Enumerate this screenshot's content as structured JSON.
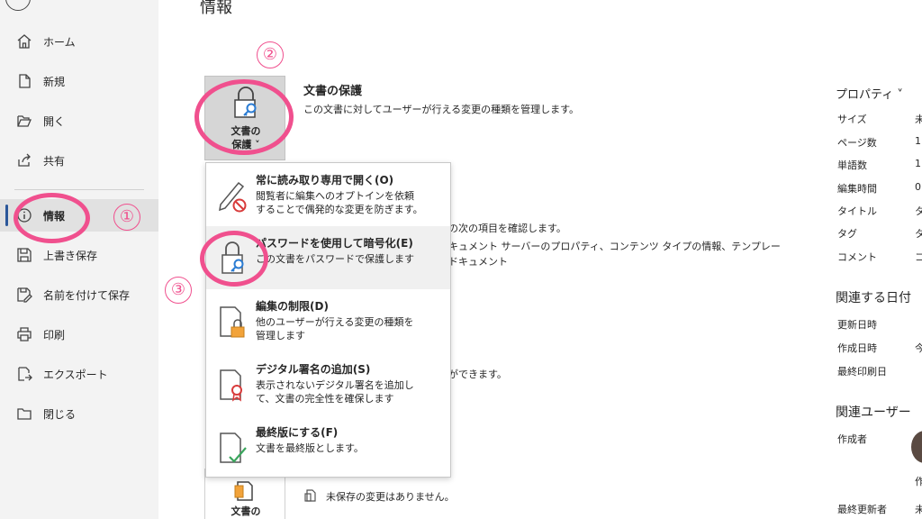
{
  "page": {
    "title": "情報"
  },
  "nav": {
    "items": [
      {
        "label": "ホーム",
        "icon": "home-icon"
      },
      {
        "label": "新規",
        "icon": "new-doc-icon"
      },
      {
        "label": "開く",
        "icon": "folder-open-icon"
      },
      {
        "label": "共有",
        "icon": "share-icon"
      },
      {
        "label": "情報",
        "icon": "info-icon",
        "selected": true
      },
      {
        "label": "上書き保存",
        "icon": "save-icon"
      },
      {
        "label": "名前を付けて保存",
        "icon": "save-as-icon"
      },
      {
        "label": "印刷",
        "icon": "print-icon"
      },
      {
        "label": "エクスポート",
        "icon": "export-icon"
      },
      {
        "label": "閉じる",
        "icon": "close-folder-icon"
      }
    ]
  },
  "protect": {
    "button_line1": "文書の",
    "button_line2": "保護 ˅",
    "title": "文書の保護",
    "description": "この文書に対してユーザーが行える変更の種類を管理します。"
  },
  "inspect": {
    "line1": "の次の項目を確認します。",
    "line2": "キュメント サーバーのプロパティ、コンテンツ タイプの情報、テンプレー",
    "line3": "ドキュメント"
  },
  "versions": {
    "description": "ができます。"
  },
  "manage": {
    "button_label": "文書の",
    "status": "未保存の変更はありません。"
  },
  "dropdown": {
    "items": [
      {
        "title": "常に読み取り専用で開く(O)",
        "description": "閲覧者に編集へのオプトインを依頼\nすることで偶発的な変更を防ぎます。",
        "icon": "read-only-pencil-icon"
      },
      {
        "title": "パスワードを使用して暗号化(E)",
        "description": "この文書をパスワードで保護します",
        "icon": "lock-key-icon"
      },
      {
        "title": "編集の制限(D)",
        "description": "他のユーザーが行える変更の種類を\n管理します",
        "icon": "restrict-editing-icon"
      },
      {
        "title": "デジタル署名の追加(S)",
        "description": "表示されないデジタル署名を追加し\nて、文書の完全性を確保します",
        "icon": "digital-signature-icon"
      },
      {
        "title": "最終版にする(F)",
        "description": "文書を最終版とします。",
        "icon": "mark-final-icon"
      }
    ]
  },
  "properties": {
    "header": "プロパティ ˅",
    "rows": [
      {
        "label": "サイズ",
        "value": "未"
      },
      {
        "label": "ページ数",
        "value": "1"
      },
      {
        "label": "単語数",
        "value": "1"
      },
      {
        "label": "編集時間",
        "value": "0"
      },
      {
        "label": "タイトル",
        "value": "タ"
      },
      {
        "label": "タグ",
        "value": "タ"
      },
      {
        "label": "コメント",
        "value": "コ"
      }
    ]
  },
  "related_dates": {
    "header": "関連する日付",
    "rows": [
      {
        "label": "更新日時",
        "value": ""
      },
      {
        "label": "作成日時",
        "value": "今"
      },
      {
        "label": "最終印刷日",
        "value": ""
      }
    ]
  },
  "related_people": {
    "header": "関連ユーザー",
    "author_label": "作成者",
    "author_value": "作",
    "last_modified_label": "最終更新者",
    "last_modified_value": "未"
  },
  "annotations": {
    "one": "①",
    "two": "②",
    "three": "③",
    "color": "#f0508e"
  }
}
